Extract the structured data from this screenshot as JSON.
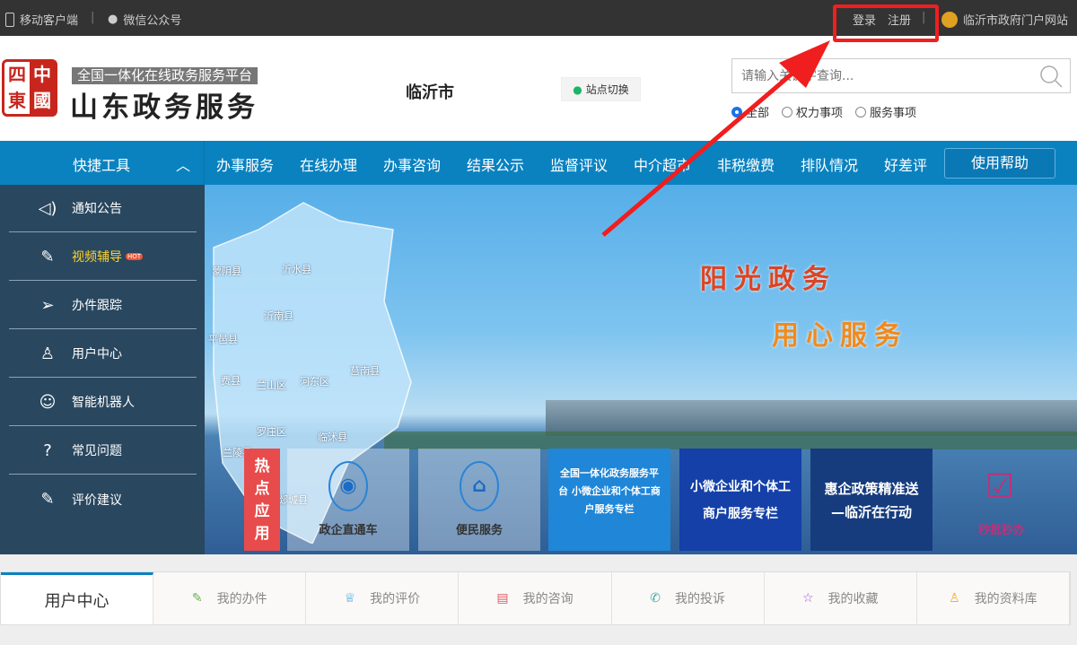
{
  "topbar": {
    "mobile": "移动客户端",
    "wechat": "微信公众号",
    "login": "登录",
    "register": "注册",
    "portal": "临沂市政府门户网站"
  },
  "header": {
    "seal": [
      "四",
      "中",
      "東",
      "國"
    ],
    "slogan": "全国一体化在线政务服务平台",
    "brand": "山东政务服务",
    "city": "临沂市",
    "switch": "站点切换",
    "search_placeholder": "请输入关键字查询...",
    "radios": [
      "全部",
      "权力事项",
      "服务事项"
    ]
  },
  "nav": {
    "quick": "快捷工具",
    "items": [
      "办事服务",
      "在线办理",
      "办事咨询",
      "结果公示",
      "监督评议",
      "中介超市",
      "非税缴费",
      "排队情况",
      "好差评"
    ],
    "help": "使用帮助"
  },
  "sidebar": {
    "items": [
      "通知公告",
      "视频辅导",
      "办件跟踪",
      "用户中心",
      "智能机器人",
      "常见问题",
      "评价建议"
    ],
    "hot": "HOT"
  },
  "banner": {
    "slogan1": "阳光政务",
    "slogan2": "用心服务",
    "map": [
      "蒙阴县",
      "沂水县",
      "平邑县",
      "沂南县",
      "费县",
      "兰山区",
      "河东区",
      "莒南县",
      "罗庄区",
      "临沭县",
      "兰陵县",
      "郯城县"
    ],
    "hot_apps": "热点应用",
    "tiles": [
      "政企直通车",
      "便民服务",
      "全国一体化政务服务平台 小微企业和个体工商户服务专栏",
      "小微企业和个体工商户服务专栏",
      "惠企政策精准送 —临沂在行动",
      "秒批秒办"
    ]
  },
  "bottom": {
    "items": [
      "用户中心",
      "我的办件",
      "我的评价",
      "我的咨询",
      "我的投诉",
      "我的收藏",
      "我的资料库"
    ]
  },
  "colors": {
    "nav": "#0a82c0",
    "annotation": "#f01e1e"
  }
}
